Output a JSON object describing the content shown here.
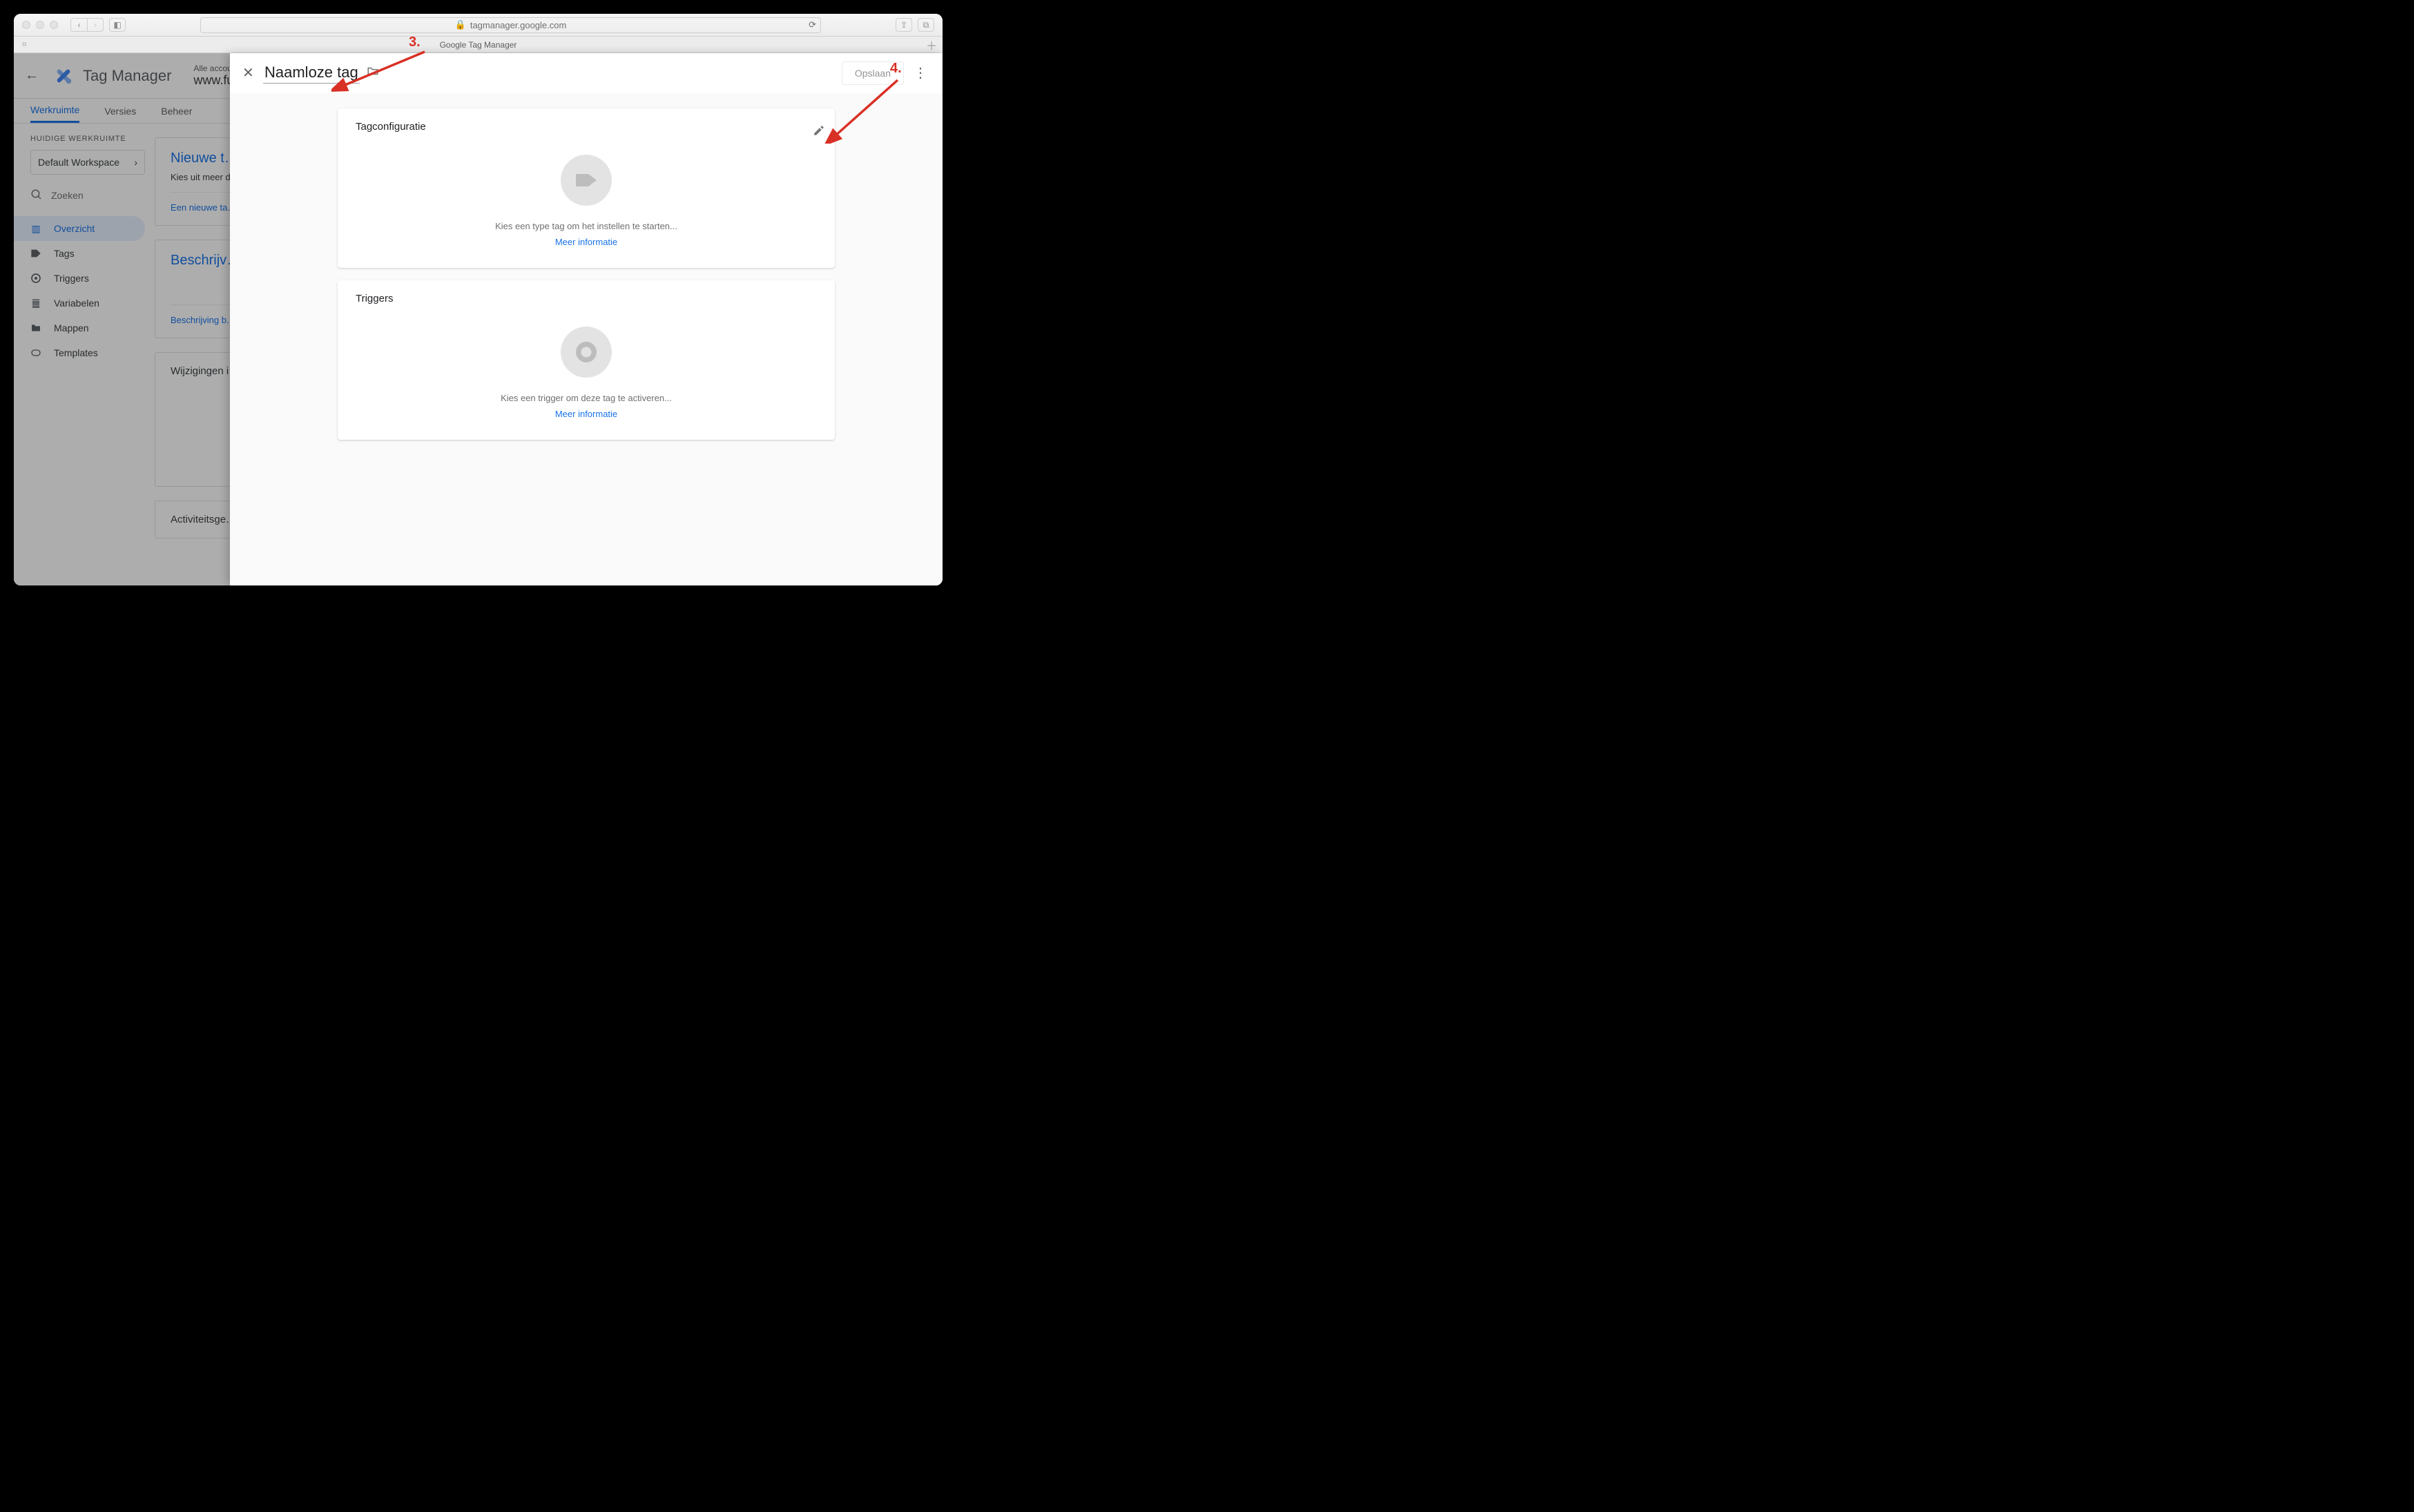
{
  "browser": {
    "url_host": "tagmanager.google.com",
    "tab_title": "Google Tag Manager"
  },
  "header": {
    "app_name": "Tag Manager",
    "breadcrumb_top": "Alle accounts > Fu…",
    "breadcrumb_bottom": "www.futy.n…"
  },
  "tabs": {
    "workspace": "Werkruimte",
    "versions": "Versies",
    "admin": "Beheer"
  },
  "sidebar": {
    "section_label": "HUIDIGE WERKRUIMTE",
    "workspace_name": "Default Workspace",
    "search_placeholder": "Zoeken",
    "items": [
      {
        "label": "Overzicht"
      },
      {
        "label": "Tags"
      },
      {
        "label": "Triggers"
      },
      {
        "label": "Variabelen"
      },
      {
        "label": "Mappen"
      },
      {
        "label": "Templates"
      }
    ]
  },
  "content": {
    "new_tag_title": "Nieuwe t…",
    "new_tag_sub": "Kies uit meer da… tagtypen.",
    "new_tag_link": "Een nieuwe ta…",
    "desc_title": "Beschrijv…",
    "desc_link": "Beschrijving b…",
    "changes_title": "Wijzigingen i…",
    "activity_title": "Activiteitsge…"
  },
  "modal": {
    "tag_name": "Naamloze tag",
    "save_label": "Opslaan",
    "config_title": "Tagconfiguratie",
    "config_empty": "Kies een type tag om het instellen te starten...",
    "more_info": "Meer informatie",
    "triggers_title": "Triggers",
    "triggers_empty": "Kies een trigger om deze tag te activeren..."
  },
  "annotations": {
    "a3": "3.",
    "a4": "4."
  }
}
